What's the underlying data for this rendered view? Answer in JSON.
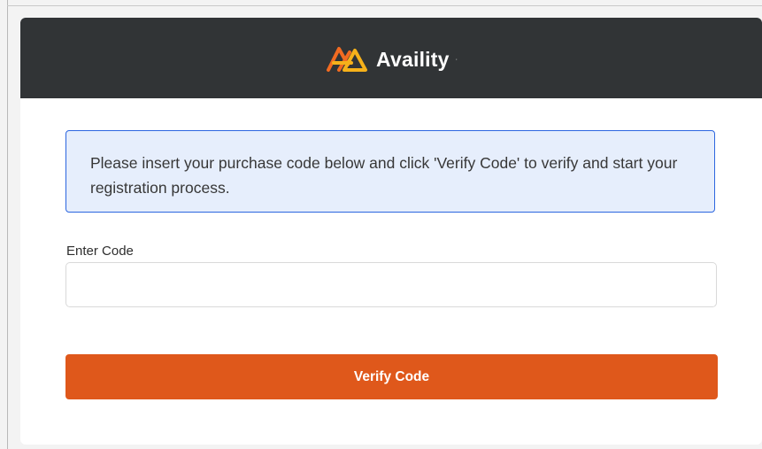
{
  "brand": {
    "name": "Availity",
    "trademark": "·",
    "logo_icon": "availity-logo-icon",
    "header_color": "#313436",
    "accent_orange": "#df581b",
    "logo_orange": "#f26b21",
    "logo_yellow": "#f6b11a"
  },
  "info": {
    "message": "Please insert your purchase code below and click 'Verify Code' to verify and start your registration process.",
    "border_color": "#2c66e0",
    "background_color": "#e6eefc"
  },
  "form": {
    "code_label": "Enter Code",
    "code_value": "",
    "code_placeholder": "",
    "verify_label": "Verify Code"
  }
}
